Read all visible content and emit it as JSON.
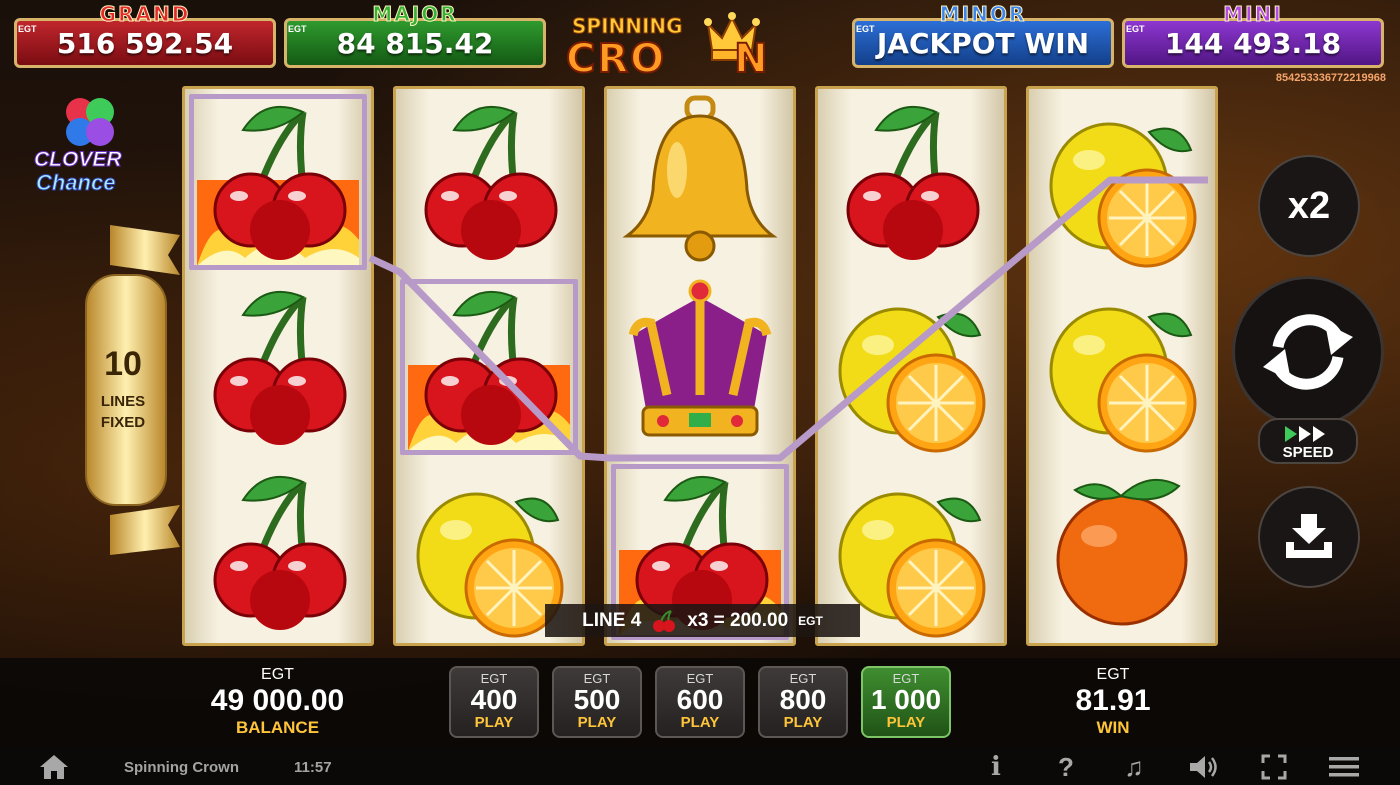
{
  "jackpots": {
    "grand": {
      "title": "GRAND",
      "value": "516 592.54",
      "currency": "EGT"
    },
    "major": {
      "title": "MAJOR",
      "value": "84 815.42",
      "currency": "EGT"
    },
    "minor": {
      "title": "MINOR",
      "value": "JACKPOT WIN",
      "currency": "EGT"
    },
    "mini": {
      "title": "MINI",
      "value": "144 493.18",
      "currency": "EGT"
    }
  },
  "serial_number": "854253336772219968",
  "logo": {
    "line1": "SPINNING",
    "line2": "CRO",
    "line3": "N"
  },
  "clover": {
    "line1": "CLOVER",
    "line2": "Chance"
  },
  "lines_banner": {
    "number": "10",
    "line1": "LINES",
    "line2": "FIXED"
  },
  "reels": [
    [
      "cherry-fire",
      "cherry",
      "cherry"
    ],
    [
      "cherry",
      "cherry-fire",
      "lemon"
    ],
    [
      "bell",
      "crown",
      "cherry-fire"
    ],
    [
      "cherry",
      "lemon",
      "lemon"
    ],
    [
      "lemon",
      "lemon",
      "orange"
    ]
  ],
  "win_line": {
    "line": "LINE 4",
    "multiplier": "x3 = 200.00",
    "currency": "EGT",
    "symbol": "cherry-icon"
  },
  "controls": {
    "x2_label": "x2",
    "speed_label": "SPEED"
  },
  "balance": {
    "currency": "EGT",
    "value": "49 000.00",
    "label": "BALANCE"
  },
  "bets": [
    {
      "currency": "EGT",
      "value": "400",
      "label": "PLAY",
      "selected": false
    },
    {
      "currency": "EGT",
      "value": "500",
      "label": "PLAY",
      "selected": false
    },
    {
      "currency": "EGT",
      "value": "600",
      "label": "PLAY",
      "selected": false
    },
    {
      "currency": "EGT",
      "value": "800",
      "label": "PLAY",
      "selected": false
    },
    {
      "currency": "EGT",
      "value": "1 000",
      "label": "PLAY",
      "selected": true
    }
  ],
  "win": {
    "currency": "EGT",
    "value": "81.91",
    "label": "WIN"
  },
  "status_bar": {
    "game_name": "Spinning Crown",
    "time": "11:57",
    "icons": [
      "home-icon",
      "info-icon",
      "help-icon",
      "music-icon",
      "volume-icon",
      "fullscreen-icon",
      "menu-icon"
    ]
  },
  "colors": {
    "accent_gold": "#ffc53a",
    "selected_bet": "#3f8e30",
    "payline": "#b79ac7"
  }
}
